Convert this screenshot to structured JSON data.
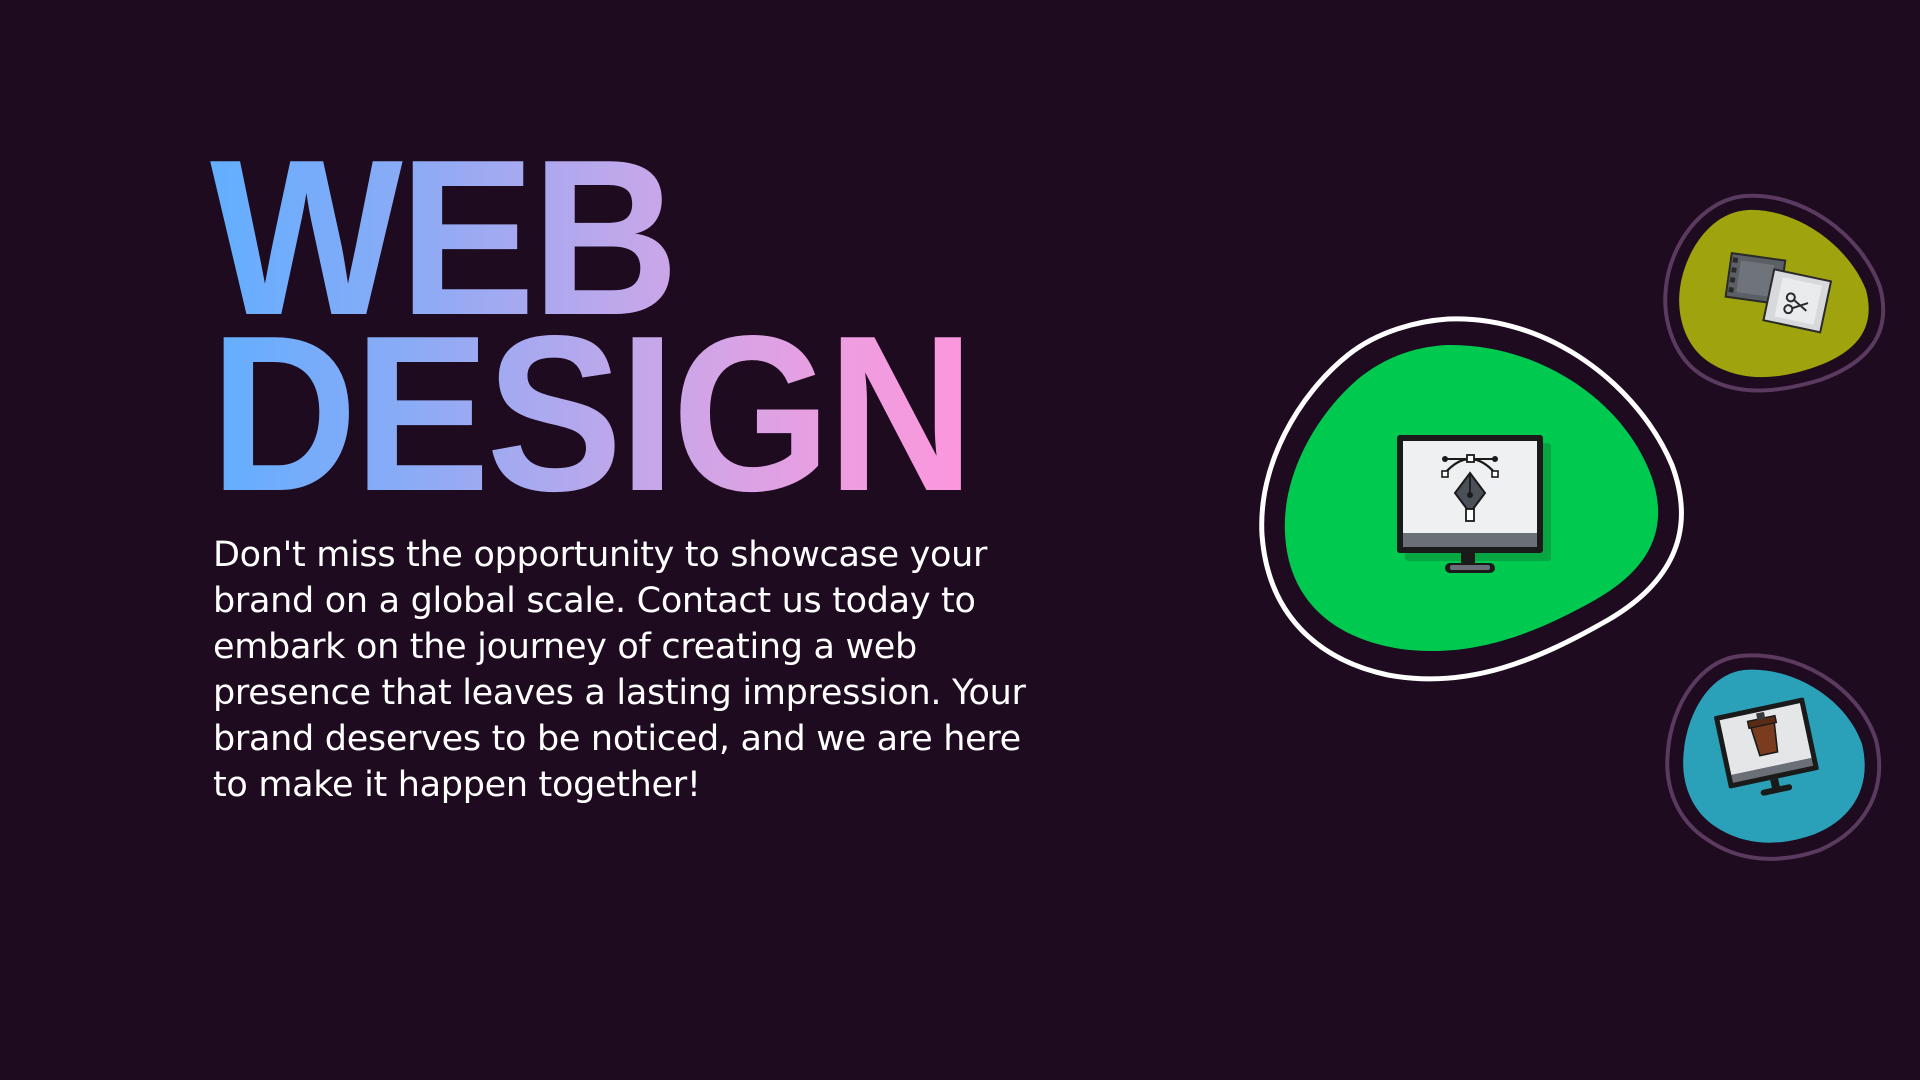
{
  "hero": {
    "title_line1": "WEB",
    "title_line2": "DESIGN",
    "body": "Don't miss the opportunity to showcase your brand on a global scale. Contact us today to embark on the journey of creating a web presence that leaves a lasting impression. Your brand deserves to be noticed, and we are here to make it happen together!"
  },
  "colors": {
    "background": "#1e0b1f",
    "gradient_start": "#62aeff",
    "gradient_end": "#ff5cb0",
    "blob_main": "#00c950",
    "blob_top": "#9ea30e",
    "blob_bottom": "#2aa0b9"
  },
  "icons": {
    "main": "monitor-pen-tool-icon",
    "top": "film-scissors-icon",
    "bottom": "monitor-cup-icon"
  }
}
